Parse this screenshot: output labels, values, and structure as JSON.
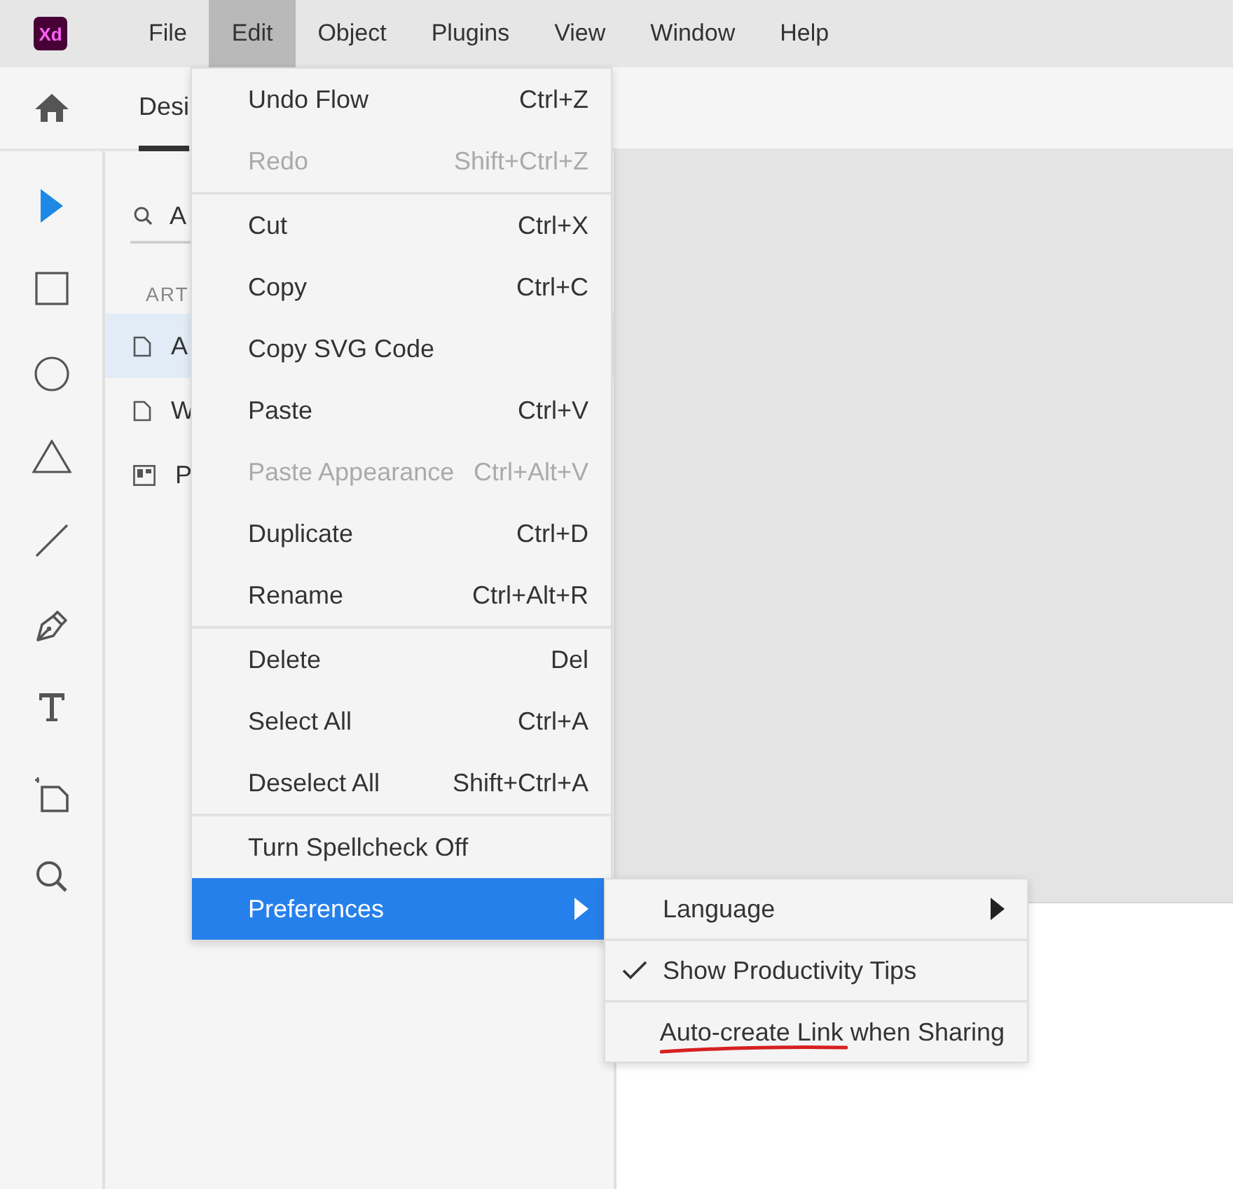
{
  "app": {
    "logo": "Xd"
  },
  "menubar": [
    {
      "label": "File",
      "selected": false
    },
    {
      "label": "Edit",
      "selected": true
    },
    {
      "label": "Object",
      "selected": false
    },
    {
      "label": "Plugins",
      "selected": false
    },
    {
      "label": "View",
      "selected": false
    },
    {
      "label": "Window",
      "selected": false
    },
    {
      "label": "Help",
      "selected": false
    }
  ],
  "toolbar": {
    "tabs": [
      {
        "label": "Desi",
        "selected": true
      }
    ]
  },
  "tools": [
    {
      "kind": "select",
      "selected": true
    },
    {
      "kind": "rectangle",
      "selected": false
    },
    {
      "kind": "ellipse",
      "selected": false
    },
    {
      "kind": "polygon",
      "selected": false
    },
    {
      "kind": "line",
      "selected": false
    },
    {
      "kind": "pen",
      "selected": false
    },
    {
      "kind": "text",
      "selected": false
    },
    {
      "kind": "artboard",
      "selected": false
    },
    {
      "kind": "zoom",
      "selected": false
    }
  ],
  "layers_panel": {
    "search": {
      "placeholder": "A"
    },
    "section": "ART",
    "items": [
      {
        "label": "A",
        "kind": "page",
        "selected": true
      },
      {
        "label": "W",
        "kind": "page",
        "selected": false
      },
      {
        "label": "P",
        "kind": "board",
        "selected": false
      }
    ]
  },
  "edit_menu": {
    "groups": [
      [
        {
          "label": "Undo Flow",
          "shortcut": "Ctrl+Z",
          "disabled": false
        },
        {
          "label": "Redo",
          "shortcut": "Shift+Ctrl+Z",
          "disabled": true
        }
      ],
      [
        {
          "label": "Cut",
          "shortcut": "Ctrl+X",
          "disabled": false
        },
        {
          "label": "Copy",
          "shortcut": "Ctrl+C",
          "disabled": false
        },
        {
          "label": "Copy SVG Code",
          "disabled": false
        },
        {
          "label": "Paste",
          "shortcut": "Ctrl+V",
          "disabled": false
        },
        {
          "label": "Paste Appearance",
          "shortcut": "Ctrl+Alt+V",
          "disabled": true
        },
        {
          "label": "Duplicate",
          "shortcut": "Ctrl+D",
          "disabled": false
        },
        {
          "label": "Rename",
          "shortcut": "Ctrl+Alt+R",
          "disabled": false
        }
      ],
      [
        {
          "label": "Delete",
          "shortcut": "Del",
          "disabled": false
        },
        {
          "label": "Select All",
          "shortcut": "Ctrl+A",
          "disabled": false
        },
        {
          "label": "Deselect All",
          "shortcut": "Shift+Ctrl+A",
          "disabled": false
        }
      ],
      [
        {
          "label": "Turn Spellcheck Off",
          "disabled": false
        },
        {
          "label": "Preferences",
          "disabled": false,
          "selected": true,
          "submenu": true
        }
      ]
    ]
  },
  "preferences_submenu": [
    {
      "label": "Language",
      "checked": false,
      "submenu": true
    },
    {
      "label": "Show Productivity Tips",
      "checked": true,
      "submenu": false
    },
    {
      "label": "Auto-create Link when Sharing",
      "checked": false,
      "submenu": false
    }
  ]
}
